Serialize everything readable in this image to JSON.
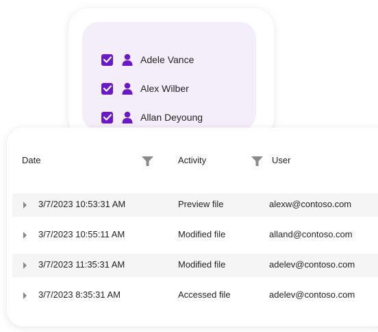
{
  "filter_panel": {
    "users": [
      {
        "name": "Adele Vance",
        "checked": true
      },
      {
        "name": "Alex Wilber",
        "checked": true
      },
      {
        "name": "Allan Deyoung",
        "checked": true
      }
    ]
  },
  "table": {
    "headers": {
      "date": "Date",
      "activity": "Activity",
      "user": "User"
    },
    "rows": [
      {
        "date": "3/7/2023 10:53:31 AM",
        "activity": "Preview file",
        "user": "alexw@contoso.com"
      },
      {
        "date": "3/7/2023 10:55:11 AM",
        "activity": "Modified file",
        "user": "alland@contoso.com"
      },
      {
        "date": "3/7/2023 11:35:31 AM",
        "activity": "Modified file",
        "user": "adelev@contoso.com"
      },
      {
        "date": "3/7/2023 8:35:31 AM",
        "activity": "Accessed file",
        "user": "adelev@contoso.com"
      }
    ]
  },
  "colors": {
    "accent": "#6a19c8",
    "panel_bg": "#f4eefb",
    "row_shade": "#f5f5f5",
    "icon_gray": "#8a8a8a"
  },
  "icons": {
    "checkbox": "checkbox-checked-icon",
    "user": "person-icon",
    "filter": "funnel-icon",
    "expand": "caret-right-icon"
  }
}
